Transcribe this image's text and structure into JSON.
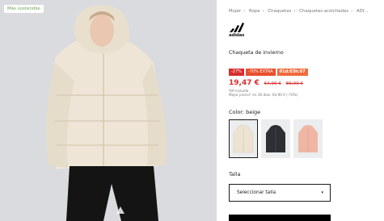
{
  "badge": "Más sostenible",
  "breadcrumb": [
    "Mujer",
    "Ropa",
    "Chaquetas",
    "Chaquetas acolchadas",
    "ADI..."
  ],
  "brand": "adidas",
  "product_name": "Chaqueta de invierno",
  "promo": {
    "discount": "-27%",
    "extra": "-70% EXTRA",
    "timer": "01d:03h:07"
  },
  "price": {
    "current": "19,47 €",
    "was1": "64,90 €",
    "was2": "89,90 €"
  },
  "vat_note": "IVA incluido",
  "lowest_price_note": "Mejor precio* en 30 días: 64,90 € (-70%)",
  "colour_label": "Color: beige",
  "swatches": [
    {
      "name": "beige",
      "color": "#ede3d2",
      "selected": true
    },
    {
      "name": "negro",
      "color": "#2d2f33",
      "selected": false
    },
    {
      "name": "rosa",
      "color": "#f0b6a4",
      "selected": false
    }
  ],
  "size": {
    "label": "Talla",
    "placeholder": "Seleccionar talla"
  }
}
